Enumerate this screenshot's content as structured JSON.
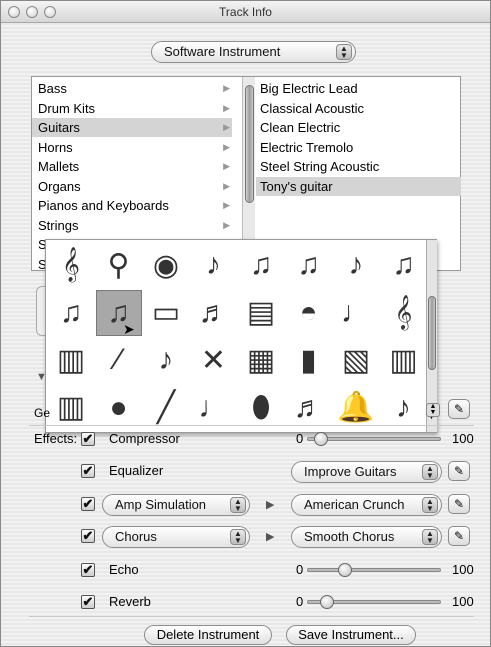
{
  "window": {
    "title": "Track Info"
  },
  "instrument_type": {
    "selected": "Software Instrument"
  },
  "categories": [
    "Bass",
    "Drum Kits",
    "Guitars",
    "Horns",
    "Mallets",
    "Organs",
    "Pianos and Keyboards",
    "Strings",
    "Synth Basics",
    "S"
  ],
  "selected_category": "Guitars",
  "instruments": [
    "Big Electric Lead",
    "Classical Acoustic",
    "Clean Electric",
    "Electric Tremolo",
    "Steel String Acoustic",
    "Tony's guitar"
  ],
  "selected_instrument": "Tony's guitar",
  "icon_palette": {
    "rows": [
      [
        "french-horn-icon",
        "mallets-icon",
        "gong-icon",
        "acoustic-guitar-icon",
        "electric-guitar-icon",
        "electric-guitar-icon",
        "acoustic-guitar-icon",
        "electric-guitar-icon"
      ],
      [
        "electric-guitar-icon",
        "electric-guitar-icon",
        "tube-icon",
        "electric-bass-icon",
        "harmonica-icon",
        "cymbal-icon",
        "trumpets-icon",
        "french-horn-icon"
      ],
      [
        "keyboard-icon",
        "flute-icon",
        "mandolin-icon",
        "drumsticks-icon",
        "synth-icon",
        "pan-flute-icon",
        "vibraphone-icon",
        "keyboard-icon"
      ],
      [
        "keyboard-icon",
        "maracas-icon",
        "clarinet-icon",
        "saxophone-icon",
        "eggs-icon",
        "sitar-icon",
        "bell-icon",
        "violin-icon"
      ]
    ],
    "selected_row": 1,
    "selected_col": 1
  },
  "generator": {
    "label": "Ge"
  },
  "effects": {
    "label": "Effects:",
    "items": [
      {
        "name": "Compressor",
        "checked": true,
        "type": "slider",
        "min": "0",
        "max": "100",
        "level": 0.05
      },
      {
        "name": "Equalizer",
        "checked": true,
        "type": "preset",
        "preset": "Improve Guitars"
      },
      {
        "name": "Amp Simulation",
        "checked": true,
        "type": "popup-preset",
        "preset": "American Crunch"
      },
      {
        "name": "Chorus",
        "checked": true,
        "type": "popup-preset",
        "preset": "Smooth Chorus"
      },
      {
        "name": "Echo",
        "checked": true,
        "type": "slider",
        "min": "0",
        "max": "100",
        "level": 0.25
      },
      {
        "name": "Reverb",
        "checked": true,
        "type": "slider",
        "min": "0",
        "max": "100",
        "level": 0.1
      }
    ]
  },
  "buttons": {
    "delete": "Delete Instrument",
    "save": "Save Instrument..."
  },
  "glyphs": {
    "check": "✔",
    "edit": "✎",
    "updown": "▲▼",
    "right": "▶"
  }
}
